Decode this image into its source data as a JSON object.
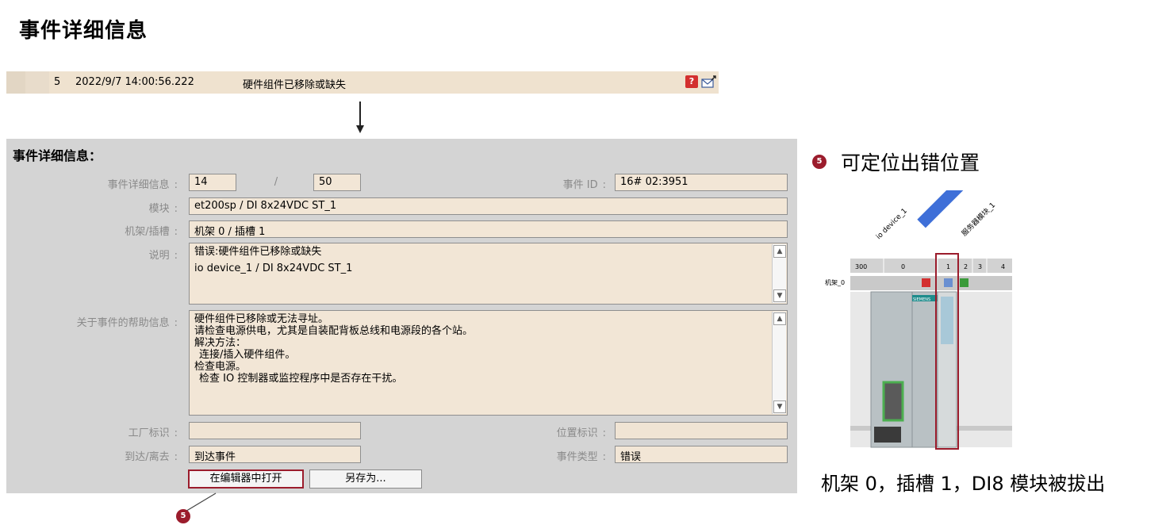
{
  "page_title": "事件详细信息",
  "event_row": {
    "number": "5",
    "timestamp": "2022/9/7 14:00:56.222",
    "description": "硬件组件已移除或缺失"
  },
  "details": {
    "title": "事件详细信息：",
    "labels": {
      "event_detail": "事件详细信息",
      "event_id": "事件 ID",
      "module": "模块",
      "rack_slot": "机架/插槽",
      "explanation": "说明",
      "help": "关于事件的帮助信息",
      "plant_id": "工厂标识",
      "location_id": "位置标识",
      "arrive_leave": "到达/离去",
      "event_type": "事件类型"
    },
    "colon": ":",
    "event_index": "14",
    "separator": "/",
    "event_total": "50",
    "event_id": "16# 02:3951",
    "module": "et200sp / DI 8x24VDC ST_1",
    "rack_slot": "机架 0 / 插槽 1",
    "explanation_lines": [
      "错误:硬件组件已移除或缺失",
      "io device_1 / DI 8x24VDC ST_1"
    ],
    "help_lines": [
      "硬件组件已移除或无法寻址。",
      "请检查电源供电，尤其是自装配背板总线和电源段的各个站。",
      "解决方法：",
      "连接/插入硬件组件。",
      "检查电源。",
      "检查 IO 控制器或监控程序中是否存在干扰。"
    ],
    "plant_id": "",
    "location_id": "",
    "arrive_leave": "到达事件",
    "event_type": "错误",
    "buttons": {
      "open_in_editor": "在编辑器中打开",
      "save_as": "另存为..."
    }
  },
  "callout_number": "5",
  "right_panel": {
    "heading": "可定位出错位置",
    "device_label": "io device_1",
    "module_label": "DI 8x24VDC ST_1",
    "submodule_label": "服务器模块_1",
    "rack_label": "机架_0",
    "slot_numbers": [
      "300",
      "0",
      "1",
      "2",
      "3",
      "4"
    ],
    "brand": "SIEMENS",
    "caption": "机架 0，插槽 1，DI8 模块被拔出"
  },
  "colors": {
    "accent": "#9b1c2c",
    "field_bg": "#f2e6d6",
    "panel_bg": "#d4d4d4",
    "row_bg": "#efe2cf",
    "highlight_blue": "#3e6fd8",
    "ok_green": "#3a9a3a",
    "error_red": "#d32f2f"
  }
}
